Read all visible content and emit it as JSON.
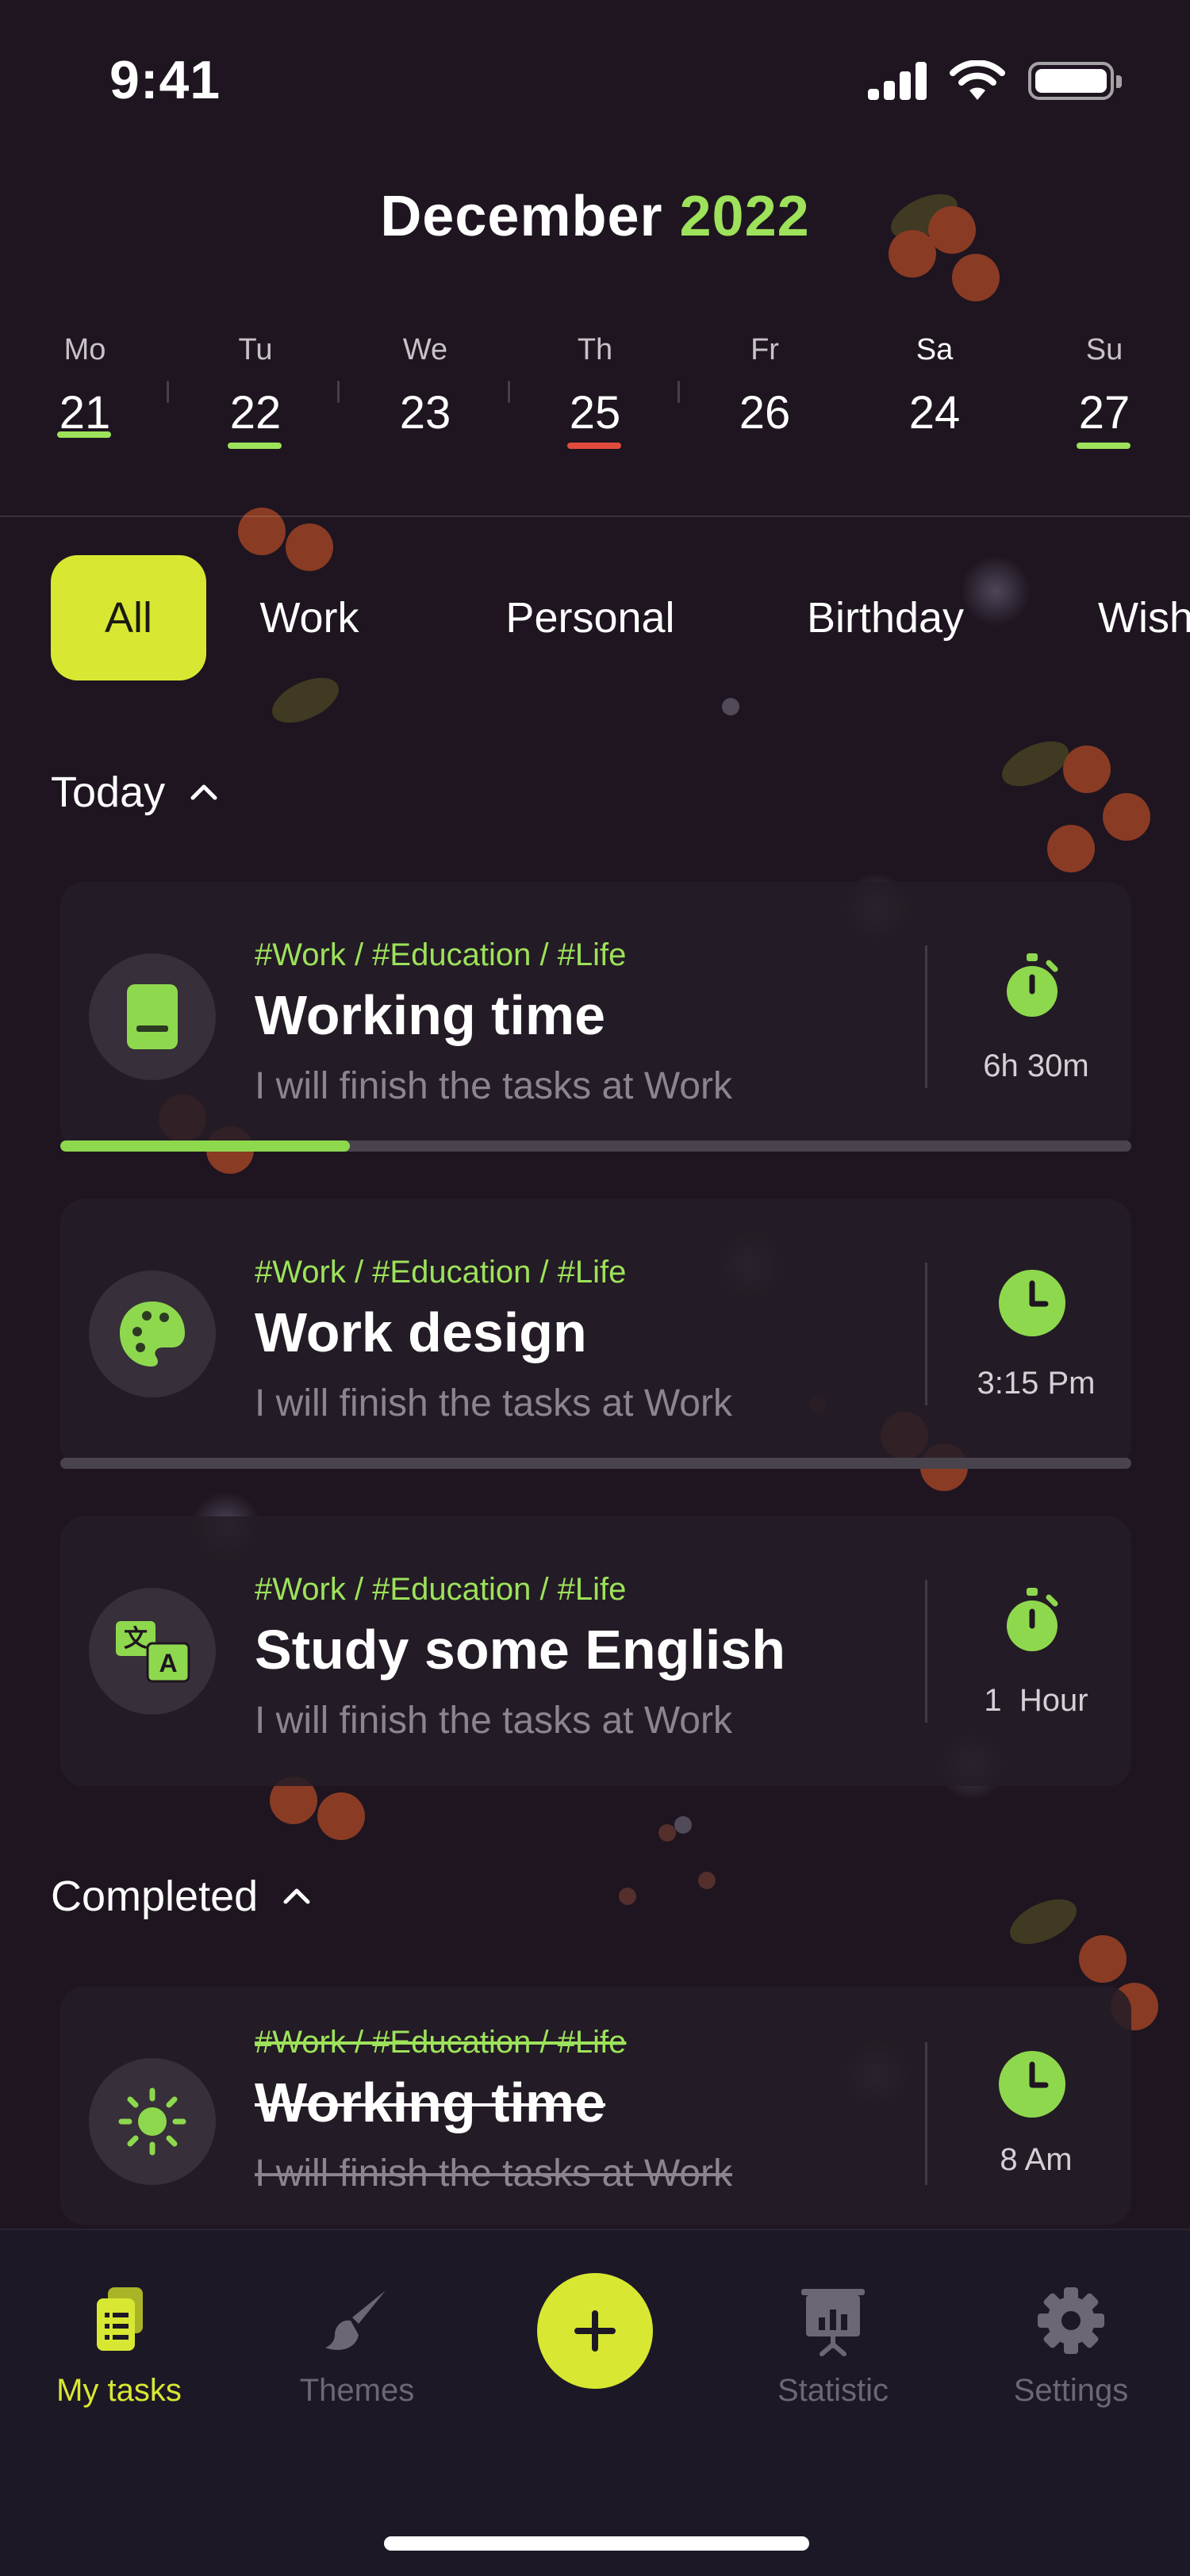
{
  "status_bar": {
    "time": "9:41"
  },
  "header": {
    "month": "December",
    "year": "2022"
  },
  "week": [
    {
      "name": "Mo",
      "num": "21",
      "mark": "#9de25a"
    },
    {
      "name": "Tu",
      "num": "22",
      "mark": "#9de25a"
    },
    {
      "name": "We",
      "num": "23",
      "mark": ""
    },
    {
      "name": "Th",
      "num": "25",
      "mark": "#e14b3b"
    },
    {
      "name": "Fr",
      "num": "26",
      "mark": ""
    },
    {
      "name": "Sa",
      "num": "24",
      "mark": ""
    },
    {
      "name": "Su",
      "num": "27",
      "mark": "#9de25a"
    }
  ],
  "filters": [
    "All",
    "Work",
    "Personal",
    "Birthday",
    "Wish"
  ],
  "active_filter": "All",
  "sections": {
    "today": "Today",
    "completed": "Completed"
  },
  "tasks": [
    {
      "tags": "#Work / #Education / #Life",
      "title": "Working time",
      "subtitle": "I will finish the tasks at Work",
      "meta": "6h 30m",
      "icon": "notebook-icon",
      "meta_icon": "stopwatch-icon",
      "progress": 0.27
    },
    {
      "tags": "#Work / #Education / #Life",
      "title": "Work design",
      "subtitle": "I will finish the tasks at Work",
      "meta": "3:15 Pm",
      "icon": "palette-icon",
      "meta_icon": "clock-icon",
      "progress": 0
    },
    {
      "tags": "#Work / #Education / #Life",
      "title": "Study some English",
      "subtitle": "I will finish the tasks at Work",
      "meta": "1  Hour",
      "icon": "translate-icon",
      "meta_icon": "stopwatch-icon"
    }
  ],
  "completed_tasks": [
    {
      "tags": "#Work / #Education / #Life",
      "title": "Working time",
      "subtitle": "I will finish the tasks at Work",
      "meta": "8 Am",
      "icon": "sun-icon",
      "meta_icon": "clock-icon"
    }
  ],
  "nav": {
    "my_tasks": "My tasks",
    "themes": "Themes",
    "statistic": "Statistic",
    "settings": "Settings"
  },
  "colors": {
    "accent": "#d8e832",
    "green": "#9de25a",
    "red": "#e14b3b",
    "background": "#1e1520"
  }
}
